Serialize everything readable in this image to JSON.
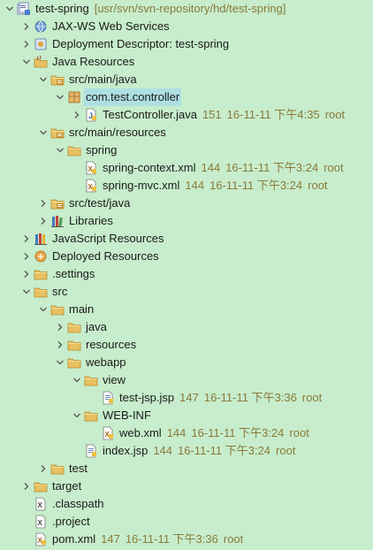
{
  "tree": [
    {
      "depth": 0,
      "toggle": "open",
      "icon": "project-icon",
      "label": "test-spring",
      "deco": [
        "[usr/svn/svn-repository/hd/test-spring]"
      ]
    },
    {
      "depth": 1,
      "toggle": "closed",
      "icon": "web-services-icon",
      "label": "JAX-WS Web Services",
      "deco": []
    },
    {
      "depth": 1,
      "toggle": "closed",
      "icon": "deployment-descriptor-icon",
      "label": "Deployment Descriptor: test-spring",
      "deco": []
    },
    {
      "depth": 1,
      "toggle": "open",
      "icon": "java-resources-icon",
      "label": "Java Resources",
      "deco": []
    },
    {
      "depth": 2,
      "toggle": "open",
      "icon": "source-folder-icon",
      "label": "src/main/java",
      "deco": []
    },
    {
      "depth": 3,
      "toggle": "open",
      "icon": "package-icon",
      "label": "com.test.controller",
      "deco": [],
      "selected": true
    },
    {
      "depth": 4,
      "toggle": "closed",
      "icon": "java-file-icon",
      "label": "TestController.java",
      "deco": [
        "151",
        "16-11-11 下午4:35",
        "root"
      ]
    },
    {
      "depth": 2,
      "toggle": "open",
      "icon": "source-folder-icon",
      "label": "src/main/resources",
      "deco": []
    },
    {
      "depth": 3,
      "toggle": "open",
      "icon": "folder-icon",
      "label": "spring",
      "deco": []
    },
    {
      "depth": 4,
      "toggle": "none",
      "icon": "xml-file-icon",
      "label": "spring-context.xml",
      "deco": [
        "144",
        "16-11-11 下午3:24",
        "root"
      ]
    },
    {
      "depth": 4,
      "toggle": "none",
      "icon": "xml-file-icon",
      "label": "spring-mvc.xml",
      "deco": [
        "144",
        "16-11-11 下午3:24",
        "root"
      ]
    },
    {
      "depth": 2,
      "toggle": "closed",
      "icon": "source-folder-icon",
      "label": "src/test/java",
      "deco": []
    },
    {
      "depth": 2,
      "toggle": "closed",
      "icon": "libraries-icon",
      "label": "Libraries",
      "deco": []
    },
    {
      "depth": 1,
      "toggle": "closed",
      "icon": "javascript-resources-icon",
      "label": "JavaScript Resources",
      "deco": []
    },
    {
      "depth": 1,
      "toggle": "closed",
      "icon": "deployed-resources-icon",
      "label": "Deployed Resources",
      "deco": []
    },
    {
      "depth": 1,
      "toggle": "closed",
      "icon": "folder-icon",
      "label": ".settings",
      "deco": []
    },
    {
      "depth": 1,
      "toggle": "open",
      "icon": "folder-icon",
      "label": "src",
      "deco": []
    },
    {
      "depth": 2,
      "toggle": "open",
      "icon": "folder-icon",
      "label": "main",
      "deco": []
    },
    {
      "depth": 3,
      "toggle": "closed",
      "icon": "folder-icon",
      "label": "java",
      "deco": []
    },
    {
      "depth": 3,
      "toggle": "closed",
      "icon": "folder-icon",
      "label": "resources",
      "deco": []
    },
    {
      "depth": 3,
      "toggle": "open",
      "icon": "folder-icon",
      "label": "webapp",
      "deco": []
    },
    {
      "depth": 4,
      "toggle": "open",
      "icon": "folder-icon",
      "label": "view",
      "deco": []
    },
    {
      "depth": 5,
      "toggle": "none",
      "icon": "jsp-file-icon",
      "label": "test-jsp.jsp",
      "deco": [
        "147",
        "16-11-11 下午3:36",
        "root"
      ]
    },
    {
      "depth": 4,
      "toggle": "open",
      "icon": "folder-icon",
      "label": "WEB-INF",
      "deco": []
    },
    {
      "depth": 5,
      "toggle": "none",
      "icon": "xml-file-icon",
      "label": "web.xml",
      "deco": [
        "144",
        "16-11-11 下午3:24",
        "root"
      ]
    },
    {
      "depth": 4,
      "toggle": "none",
      "icon": "jsp-file-icon",
      "label": "index.jsp",
      "deco": [
        "144",
        "16-11-11 下午3:24",
        "root"
      ]
    },
    {
      "depth": 2,
      "toggle": "closed",
      "icon": "folder-icon",
      "label": "test",
      "deco": []
    },
    {
      "depth": 1,
      "toggle": "closed",
      "icon": "folder-icon",
      "label": "target",
      "deco": []
    },
    {
      "depth": 1,
      "toggle": "none",
      "icon": "classpath-file-icon",
      "label": ".classpath",
      "deco": []
    },
    {
      "depth": 1,
      "toggle": "none",
      "icon": "project-file-icon",
      "label": ".project",
      "deco": []
    },
    {
      "depth": 1,
      "toggle": "none",
      "icon": "xml-file-icon",
      "label": "pom.xml",
      "deco": [
        "147",
        "16-11-11 下午3:36",
        "root"
      ]
    }
  ],
  "colors": {
    "background": "#c7edcc",
    "selection": "#aedfe3",
    "decoration": "#8a7a3a",
    "folder": "#e8c062"
  }
}
